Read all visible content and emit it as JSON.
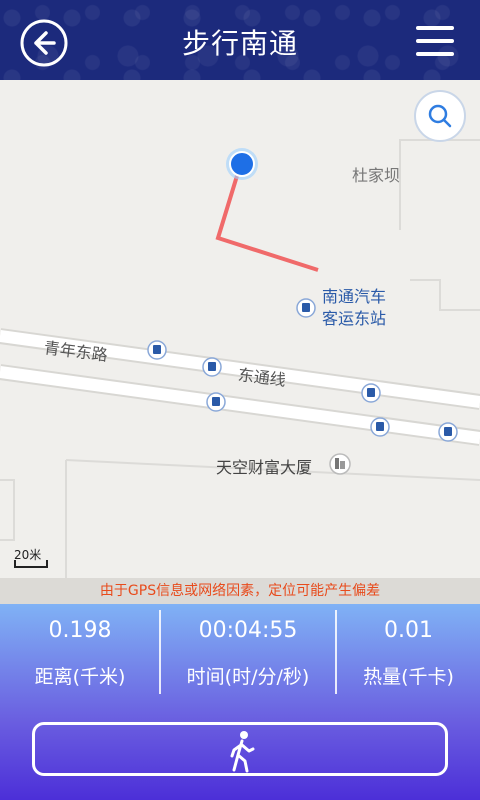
{
  "header": {
    "title": "步行南通",
    "back_icon": "back-arrow-icon",
    "menu_icon": "hamburger-menu-icon"
  },
  "map": {
    "labels": {
      "du_jia_ba": "杜家坝",
      "poi_line1": "南通汽车",
      "poi_line2": "客运东站",
      "road_qingnian": "青年东路",
      "road_dongtong": "东通线",
      "building": "天空财富大厦"
    },
    "scale_label": "20米",
    "search_icon": "search-icon",
    "colors": {
      "route": "#f06a6a",
      "location": "#1e6fe6"
    }
  },
  "warning": "由于GPS信息或网络因素，定位可能产生偏差",
  "stats": {
    "distance": {
      "value": "0.198",
      "label": "距离(千米)"
    },
    "time": {
      "value": "00:04:55",
      "label": "时间(时/分/秒)"
    },
    "calories": {
      "value": "0.01",
      "label": "热量(千卡)"
    }
  },
  "start_button_icon": "walking-person-icon"
}
